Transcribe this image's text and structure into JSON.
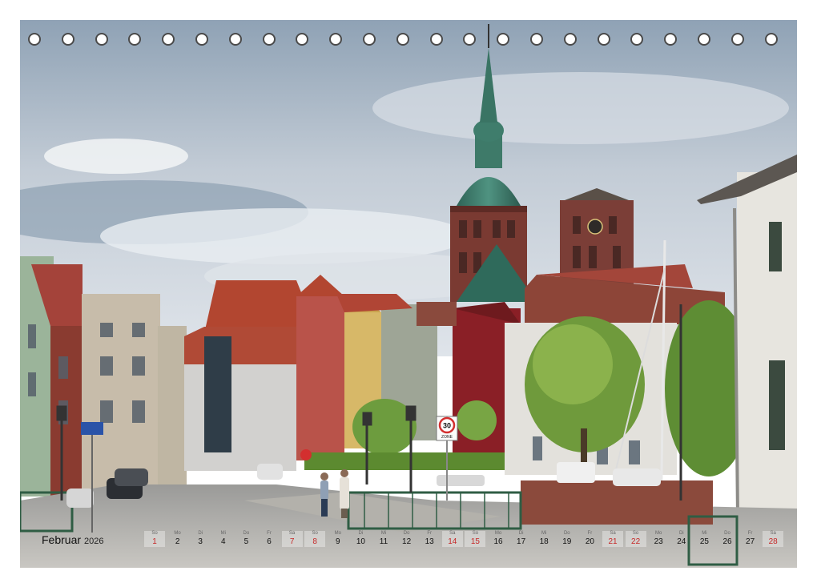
{
  "calendar": {
    "month": "Februar",
    "year": "2026",
    "days": [
      {
        "wd": "So",
        "n": "1",
        "we": true
      },
      {
        "wd": "Mo",
        "n": "2",
        "we": false
      },
      {
        "wd": "Di",
        "n": "3",
        "we": false
      },
      {
        "wd": "Mi",
        "n": "4",
        "we": false
      },
      {
        "wd": "Do",
        "n": "5",
        "we": false
      },
      {
        "wd": "Fr",
        "n": "6",
        "we": false
      },
      {
        "wd": "Sa",
        "n": "7",
        "we": true
      },
      {
        "wd": "So",
        "n": "8",
        "we": true
      },
      {
        "wd": "Mo",
        "n": "9",
        "we": false
      },
      {
        "wd": "Di",
        "n": "10",
        "we": false
      },
      {
        "wd": "Mi",
        "n": "11",
        "we": false
      },
      {
        "wd": "Do",
        "n": "12",
        "we": false
      },
      {
        "wd": "Fr",
        "n": "13",
        "we": false
      },
      {
        "wd": "Sa",
        "n": "14",
        "we": true
      },
      {
        "wd": "So",
        "n": "15",
        "we": true
      },
      {
        "wd": "Mo",
        "n": "16",
        "we": false
      },
      {
        "wd": "Di",
        "n": "17",
        "we": false
      },
      {
        "wd": "Mi",
        "n": "18",
        "we": false
      },
      {
        "wd": "Do",
        "n": "19",
        "we": false
      },
      {
        "wd": "Fr",
        "n": "20",
        "we": false
      },
      {
        "wd": "Sa",
        "n": "21",
        "we": true
      },
      {
        "wd": "So",
        "n": "22",
        "we": true
      },
      {
        "wd": "Mo",
        "n": "23",
        "we": false
      },
      {
        "wd": "Di",
        "n": "24",
        "we": false
      },
      {
        "wd": "Mi",
        "n": "25",
        "we": false
      },
      {
        "wd": "Do",
        "n": "26",
        "we": false
      },
      {
        "wd": "Fr",
        "n": "27",
        "we": false
      },
      {
        "wd": "Sa",
        "n": "28",
        "we": true
      }
    ]
  },
  "sign": {
    "speed_limit": "30",
    "zone_label": "ZONE"
  },
  "colors": {
    "weekend": "#c62828",
    "sky": "#b9c6d3",
    "spire": "#3d7a6b",
    "brick": "#8c3a2e"
  }
}
